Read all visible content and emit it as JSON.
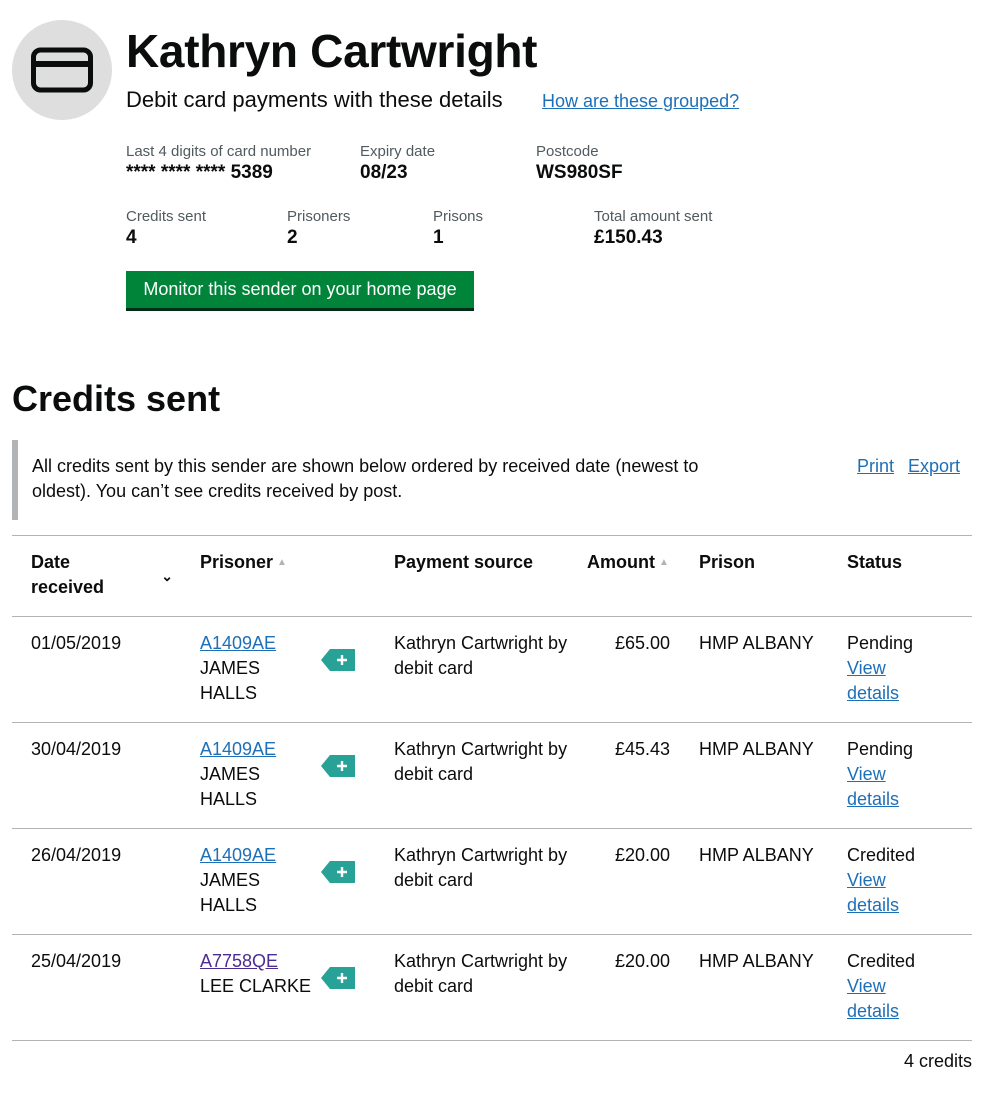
{
  "sender": {
    "name": "Kathryn Cartwright",
    "subtitle": "Debit card payments with these details",
    "grouped_link": "How are these grouped?",
    "icon": "credit-card-icon"
  },
  "details": {
    "card_label": "Last 4 digits of card number",
    "card_value": "**** **** **** 5389",
    "expiry_label": "Expiry date",
    "expiry_value": "08/23",
    "postcode_label": "Postcode",
    "postcode_value": "WS980SF",
    "credits_label": "Credits sent",
    "credits_value": "4",
    "prisoners_label": "Prisoners",
    "prisoners_value": "2",
    "prisons_label": "Prisons",
    "prisons_value": "1",
    "total_label": "Total amount sent",
    "total_value": "£150.43"
  },
  "monitor_button": "Monitor this sender on your home page",
  "section_title": "Credits sent",
  "inset": {
    "text": "All credits sent by this sender are shown below ordered by received date (newest to oldest). You can’t see credits received by post.",
    "print": "Print",
    "export": "Export"
  },
  "table": {
    "headers": {
      "date": "Date received",
      "prisoner": "Prisoner",
      "source": "Payment source",
      "amount": "Amount",
      "prison": "Prison",
      "status": "Status"
    },
    "rows": [
      {
        "date": "01/05/2019",
        "prisoner_number": "A1409AE",
        "prisoner_name": "JAMES HALLS",
        "source": "Kathryn Cartwright by debit card",
        "amount": "£65.00",
        "prison": "HMP ALBANY",
        "status": "Pending",
        "link": "View details"
      },
      {
        "date": "30/04/2019",
        "prisoner_number": "A1409AE",
        "prisoner_name": "JAMES HALLS",
        "source": "Kathryn Cartwright by debit card",
        "amount": "£45.43",
        "prison": "HMP ALBANY",
        "status": "Pending",
        "link": "View details"
      },
      {
        "date": "26/04/2019",
        "prisoner_number": "A1409AE",
        "prisoner_name": "JAMES HALLS",
        "source": "Kathryn Cartwright by debit card",
        "amount": "£20.00",
        "prison": "HMP ALBANY",
        "status": "Credited",
        "link": "View details"
      },
      {
        "date": "25/04/2019",
        "prisoner_number": "A7758QE",
        "prisoner_name": "LEE CLARKE",
        "source": "Kathryn Cartwright by debit card",
        "amount": "£20.00",
        "prison": "HMP ALBANY",
        "status": "Credited",
        "link": "View details"
      }
    ]
  },
  "footer_count": "4 credits",
  "colors": {
    "link": "#1d70b8",
    "visited_link": "#4c2c92",
    "button": "#00843a",
    "tag": "#28a197",
    "avatar_bg": "#dedede"
  }
}
